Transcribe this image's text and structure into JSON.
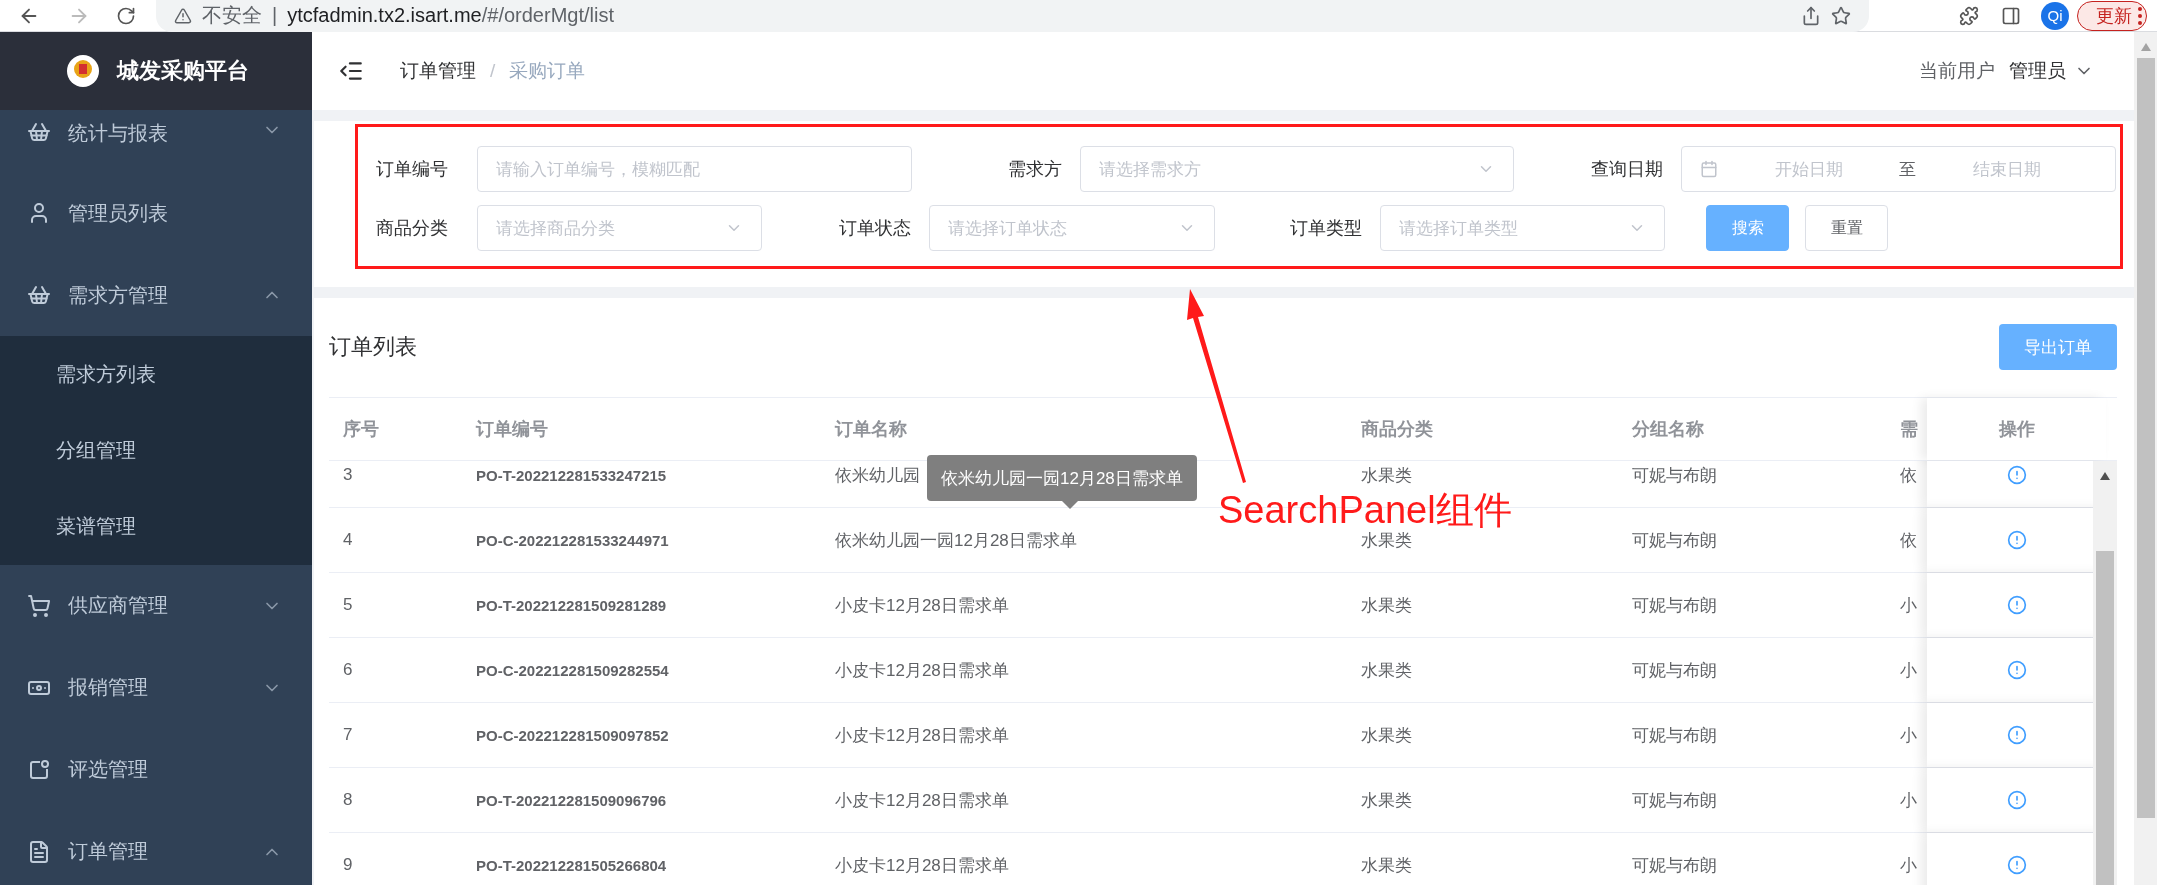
{
  "browser": {
    "security_label": "不安全",
    "separator": "|",
    "url_host": "ytcfadmin.tx2.isart.me",
    "url_path": "/#/orderMgt/list",
    "profile": "Qi",
    "update_button": "更新"
  },
  "sidebar": {
    "title": "城发采购平台",
    "items": [
      {
        "label": "统计与报表",
        "expanded": false
      },
      {
        "label": "管理员列表"
      },
      {
        "label": "需求方管理",
        "expanded": true,
        "children": [
          {
            "label": "需求方列表"
          },
          {
            "label": "分组管理"
          },
          {
            "label": "菜谱管理"
          }
        ]
      },
      {
        "label": "供应商管理",
        "expanded": false
      },
      {
        "label": "报销管理",
        "expanded": false
      },
      {
        "label": "评选管理"
      },
      {
        "label": "订单管理",
        "expanded": true
      }
    ]
  },
  "header": {
    "breadcrumb": [
      "订单管理",
      "采购订单"
    ],
    "separator": "/",
    "user_label": "当前用户",
    "user_name": "管理员"
  },
  "search_panel": {
    "fields": [
      {
        "label": "订单编号",
        "kind": "input",
        "placeholder": "请输入订单编号，模糊匹配"
      },
      {
        "label": "需求方",
        "kind": "select",
        "placeholder": "请选择需求方"
      },
      {
        "label": "查询日期",
        "kind": "daterange",
        "start_placeholder": "开始日期",
        "range_separator": "至",
        "end_placeholder": "结束日期"
      },
      {
        "label": "商品分类",
        "kind": "select",
        "placeholder": "请选择商品分类"
      },
      {
        "label": "订单状态",
        "kind": "select",
        "placeholder": "请选择订单状态"
      },
      {
        "label": "订单类型",
        "kind": "select",
        "placeholder": "请选择订单类型"
      }
    ],
    "buttons": [
      {
        "label": "搜索",
        "kind": "primary"
      },
      {
        "label": "重置",
        "kind": "default"
      }
    ]
  },
  "table": {
    "title": "订单列表",
    "export_button": "导出订单",
    "columns": [
      "序号",
      "订单编号",
      "订单名称",
      "商品分类",
      "分组名称",
      "需",
      "操作"
    ],
    "rows": [
      {
        "index": "3",
        "order_no": "PO-T-202212281533247215",
        "name": "依米幼儿园",
        "category": "水果类",
        "group": "可妮与布朗",
        "column_6": "依"
      },
      {
        "index": "4",
        "order_no": "PO-C-202212281533244971",
        "name": "依米幼儿园一园12月28日需求单",
        "category": "水果类",
        "group": "可妮与布朗",
        "column_6": "依"
      },
      {
        "index": "5",
        "order_no": "PO-T-202212281509281289",
        "name": "小皮卡12月28日需求单",
        "category": "水果类",
        "group": "可妮与布朗",
        "column_6": "小"
      },
      {
        "index": "6",
        "order_no": "PO-C-202212281509282554",
        "name": "小皮卡12月28日需求单",
        "category": "水果类",
        "group": "可妮与布朗",
        "column_6": "小"
      },
      {
        "index": "7",
        "order_no": "PO-C-202212281509097852",
        "name": "小皮卡12月28日需求单",
        "category": "水果类",
        "group": "可妮与布朗",
        "column_6": "小"
      },
      {
        "index": "8",
        "order_no": "PO-T-202212281509096796",
        "name": "小皮卡12月28日需求单",
        "category": "水果类",
        "group": "可妮与布朗",
        "column_6": "小"
      },
      {
        "index": "9",
        "order_no": "PO-T-202212281505266804",
        "name": "小皮卡12月28日需求单",
        "category": "水果类",
        "group": "可妮与布朗",
        "column_6": "小"
      }
    ],
    "tooltip": "依米幼儿园一园12月28日需求单"
  },
  "annotation": {
    "label": "SearchPanel组件"
  }
}
